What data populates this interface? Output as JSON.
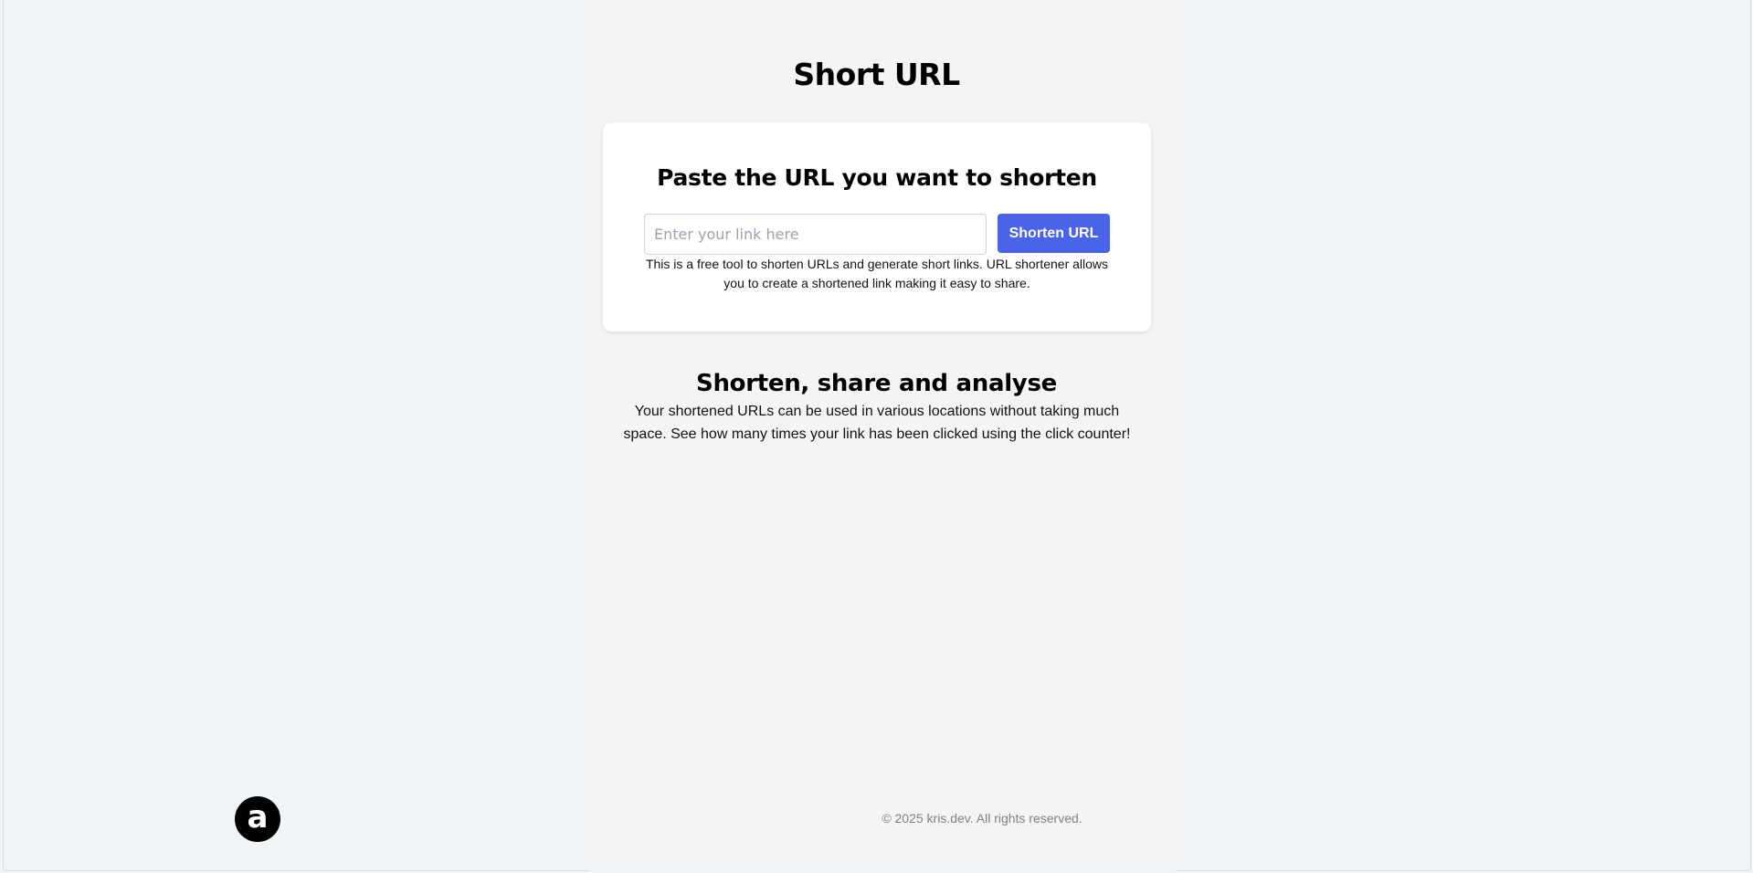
{
  "header": {
    "title": "Short URL"
  },
  "card": {
    "title": "Paste the URL you want to shorten",
    "input_placeholder": "Enter your link here",
    "input_value": "",
    "button_label": "Shorten URL",
    "description": "This is a free tool to shorten URLs and generate short links. URL shortener allows you to create a shortened link making it easy to share."
  },
  "info": {
    "title": "Shorten, share and analyse",
    "description": "Your shortened URLs can be used in various locations without taking much space. See how many times your link has been clicked using the click counter!"
  },
  "footer": {
    "logo_letter": "a",
    "copyright": "© 2025 kris.dev. All rights reserved."
  },
  "colors": {
    "accent": "#4a63e7",
    "background": "#f2f5f8",
    "card": "#ffffff"
  },
  "icons": {
    "logo": "letter-a-circle-logo"
  }
}
